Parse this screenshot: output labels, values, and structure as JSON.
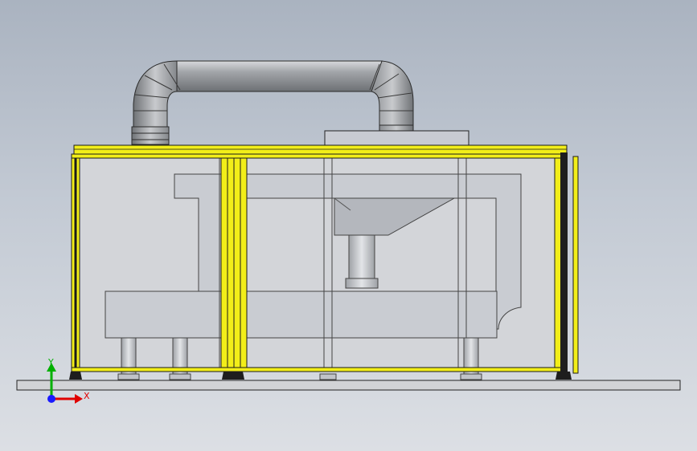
{
  "viewport": {
    "background_top": "#aab3c0",
    "background_bottom": "#dcdfe4"
  },
  "model": {
    "frame_color": "#f2ee19",
    "panel_color": "#d4d6da",
    "part_color": "#c9ccd2",
    "duct_color": "#8f9296",
    "base_color": "#d2d3d6",
    "edge_color": "#1a1a1a"
  },
  "triad": {
    "x_label": "X",
    "y_label": "Y",
    "x_color": "#e00000",
    "y_color": "#00b000",
    "z_color": "#1a1aff"
  }
}
